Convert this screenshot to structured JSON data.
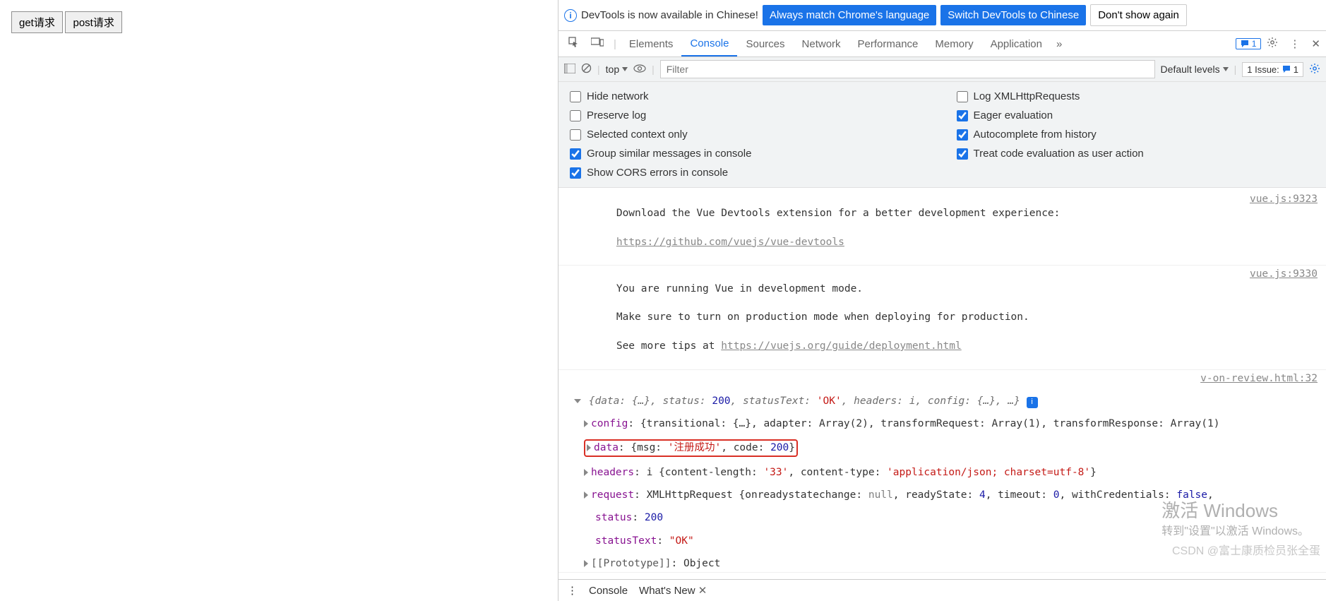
{
  "left": {
    "btn_get": "get请求",
    "btn_post": "post请求"
  },
  "infobar": {
    "text": "DevTools is now available in Chinese!",
    "btn_match": "Always match Chrome's language",
    "btn_switch": "Switch DevTools to Chinese",
    "btn_dismiss": "Don't show again"
  },
  "tabs": {
    "elements": "Elements",
    "console": "Console",
    "sources": "Sources",
    "network": "Network",
    "performance": "Performance",
    "memory": "Memory",
    "application": "Application",
    "msg_count": "1"
  },
  "toolbar": {
    "context": "top",
    "filter_placeholder": "Filter",
    "levels": "Default levels",
    "issue_label": "1 Issue:",
    "issue_count": "1"
  },
  "settings": {
    "hide_network": "Hide network",
    "preserve_log": "Preserve log",
    "selected_ctx": "Selected context only",
    "group_msgs": "Group similar messages in console",
    "show_cors": "Show CORS errors in console",
    "log_xhr": "Log XMLHttpRequests",
    "eager_eval": "Eager evaluation",
    "autocomplete": "Autocomplete from history",
    "treat_code": "Treat code evaluation as user action"
  },
  "logs": {
    "vue1_a": "Download the Vue Devtools extension for a better development experience:",
    "vue1_link": "https://github.com/vuejs/vue-devtools",
    "vue1_src": "vue.js:9323",
    "vue2_a": "You are running Vue in development mode.",
    "vue2_b": "Make sure to turn on production mode when deploying for production.",
    "vue2_c": "See more tips at ",
    "vue2_link": "https://vuejs.org/guide/deployment.html",
    "vue2_src": "vue.js:9330",
    "obj_src": "v-on-review.html:32",
    "summary_pre": "{data: {…}, status: ",
    "summary_status": "200",
    "summary_mid": ", statusText: ",
    "summary_ok": "'OK'",
    "summary_post": ", headers: i, config: {…}, …}",
    "config_k": "config",
    "config_v": ": {transitional: {…}, adapter: Array(2), transformRequest: Array(1), transformResponse: Array(1)",
    "data_k": "data",
    "data_pre": ": {msg: ",
    "data_msg": "'注册成功'",
    "data_mid": ", code: ",
    "data_code": "200",
    "data_post": "}",
    "headers_k": "headers",
    "headers_pre": ": i {content-length: ",
    "headers_len": "'33'",
    "headers_mid": ", content-type: ",
    "headers_ct": "'application/json; charset=utf-8'",
    "headers_post": "}",
    "request_k": "request",
    "request_pre": ": XMLHttpRequest {onreadystatechange: ",
    "request_null": "null",
    "request_mid1": ", readyState: ",
    "request_rs": "4",
    "request_mid2": ", timeout: ",
    "request_to": "0",
    "request_mid3": ", withCredentials: ",
    "request_wc": "false",
    "request_post": ",",
    "status_k": "status",
    "status_v": "200",
    "statustext_k": "statusText",
    "statustext_v": "\"OK\"",
    "proto_k": "[[Prototype]]",
    "proto_v": ": Object"
  },
  "drawer": {
    "console": "Console",
    "whatsnew": "What's New"
  },
  "watermark": {
    "big": "激活 Windows",
    "small": "转到\"设置\"以激活 Windows。"
  },
  "csdn": "CSDN @富士康质检员张全蛋"
}
